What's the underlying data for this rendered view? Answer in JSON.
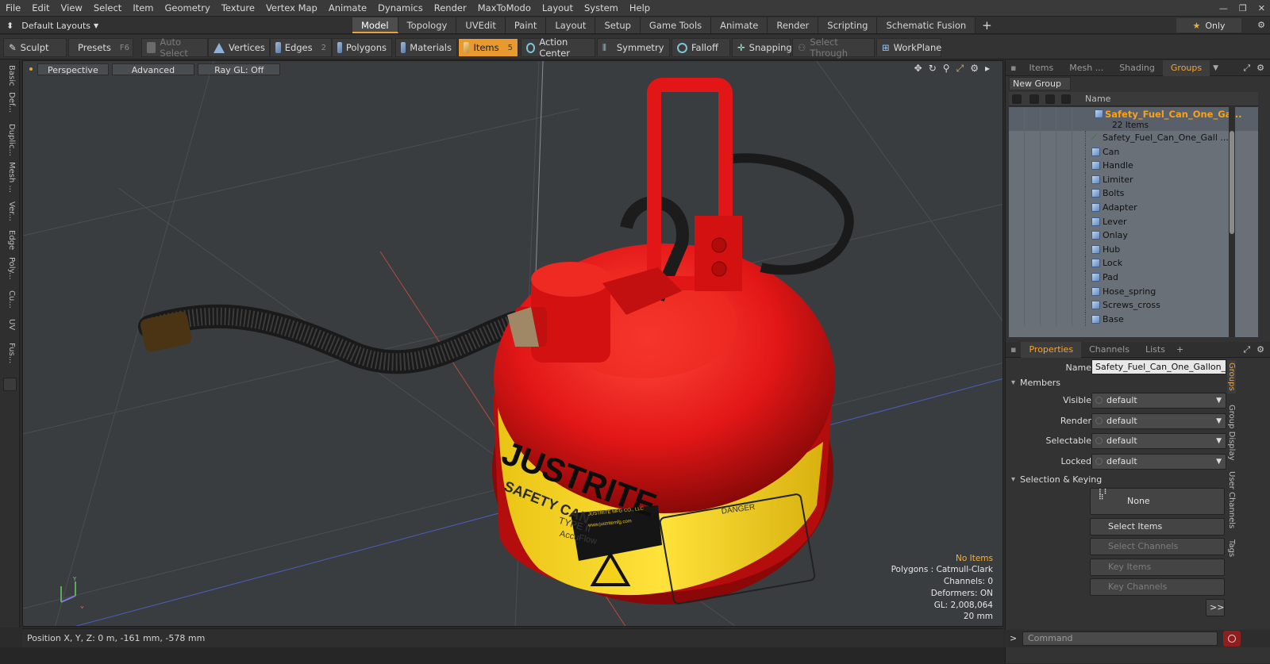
{
  "menu": [
    "File",
    "Edit",
    "View",
    "Select",
    "Item",
    "Geometry",
    "Texture",
    "Vertex Map",
    "Animate",
    "Dynamics",
    "Render",
    "MaxToModo",
    "Layout",
    "System",
    "Help"
  ],
  "layout_selector": "Default Layouts",
  "layout_tabs": [
    "Model",
    "Topology",
    "UVEdit",
    "Paint",
    "Layout",
    "Setup",
    "Game Tools",
    "Animate",
    "Render",
    "Scripting",
    "Schematic Fusion"
  ],
  "active_layout_tab": "Model",
  "only_label": "Only",
  "toolbar": {
    "sculpt": "Sculpt",
    "presets": "Presets",
    "presets_hk": "F6",
    "auto_select": "Auto Select",
    "vertices": "Vertices",
    "vertices_hk": "1",
    "edges": "Edges",
    "edges_hk": "2",
    "polygons": "Polygons",
    "materials": "Materials",
    "items": "Items",
    "items_hk": "5",
    "action_center": "Action Center",
    "symmetry": "Symmetry",
    "falloff": "Falloff",
    "snapping": "Snapping",
    "select_through": "Select Through",
    "workplane": "WorkPlane"
  },
  "left_tabs": [
    "Basic",
    "Def...",
    "Duplic...",
    "Mesh ...",
    "Ver...",
    "Edge",
    "Poly...",
    "Cu...",
    "UV",
    "Fus..."
  ],
  "viewport": {
    "view": "Perspective",
    "shading": "Advanced",
    "raygl": "Ray GL: Off",
    "info": {
      "selection": "No Items",
      "polygons": "Polygons : Catmull-Clark",
      "channels": "Channels: 0",
      "deformers": "Deformers: ON",
      "gl": "GL: 2,008,064",
      "scale": "20 mm"
    },
    "can_labels": {
      "brand": "JUSTRITE",
      "safety": "SAFETY CAN",
      "type": "TYPE II",
      "accuflow": "AccuFlow",
      "danger": "DANGER",
      "maker": "JUSTRITE MFG CO., LLC",
      "web": "www.justritemfg.com"
    }
  },
  "status": "Position X, Y, Z:   0 m, -161 mm, -578 mm",
  "right_panel": {
    "top_tabs": [
      "Items",
      "Mesh ...",
      "Shading",
      "Groups"
    ],
    "active_top_tab": "Groups",
    "new_group": "New Group",
    "col_name": "Name",
    "group_title": "Safety_Fuel_Can_One_Ga...",
    "group_count": "22 Items",
    "items": [
      "Safety_Fuel_Can_One_Gall ...",
      "Can",
      "Handle",
      "Limiter",
      "Bolts",
      "Adapter",
      "Lever",
      "Onlay",
      "Hub",
      "Lock",
      "Pad",
      "Hose_spring",
      "Screws_cross",
      "Base"
    ],
    "prop_tabs": [
      "Properties",
      "Channels",
      "Lists"
    ],
    "active_prop_tab": "Properties",
    "name_label": "Name",
    "name_value": "Safety_Fuel_Can_One_Gallon_Re",
    "members_label": "Members",
    "visible_label": "Visible",
    "visible_value": "default",
    "render_label": "Render",
    "render_value": "default",
    "selectable_label": "Selectable",
    "selectable_value": "default",
    "locked_label": "Locked",
    "locked_value": "default",
    "sel_keying_label": "Selection & Keying",
    "none_btn": "None",
    "select_items": "Select Items",
    "select_channels": "Select Channels",
    "key_items": "Key Items",
    "key_channels": "Key Channels",
    "more": ">>",
    "side_tabs": [
      "Groups",
      "Group Display",
      "User Channels",
      "Tags"
    ],
    "command_placeholder": "Command"
  },
  "colors": {
    "accent": "#e89a2e",
    "group_title": "#f6a21b",
    "can_red": "#e01414",
    "label_yellow": "#f4d21a"
  }
}
